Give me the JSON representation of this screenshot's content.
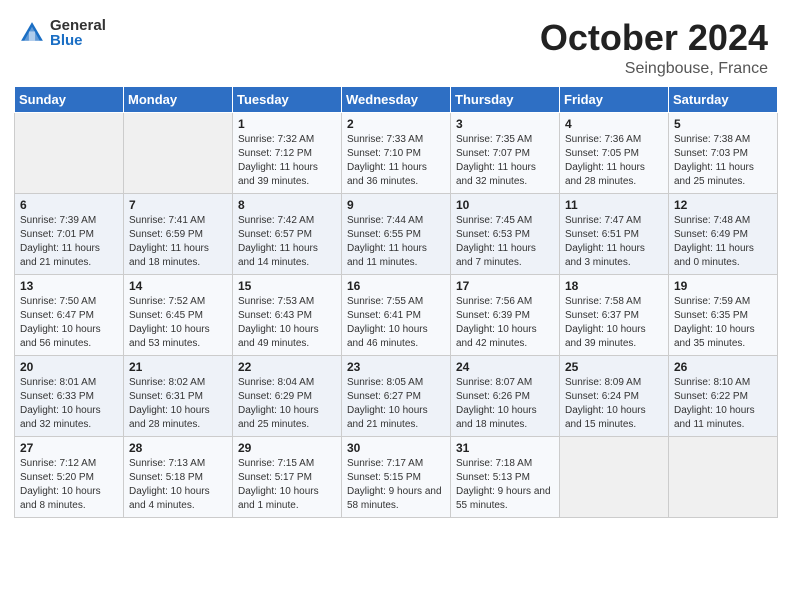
{
  "header": {
    "logo_general": "General",
    "logo_blue": "Blue",
    "month_title": "October 2024",
    "location": "Seingbouse, France"
  },
  "days_of_week": [
    "Sunday",
    "Monday",
    "Tuesday",
    "Wednesday",
    "Thursday",
    "Friday",
    "Saturday"
  ],
  "weeks": [
    [
      {
        "day": "",
        "sunrise": "",
        "sunset": "",
        "daylight": ""
      },
      {
        "day": "",
        "sunrise": "",
        "sunset": "",
        "daylight": ""
      },
      {
        "day": "1",
        "sunrise": "Sunrise: 7:32 AM",
        "sunset": "Sunset: 7:12 PM",
        "daylight": "Daylight: 11 hours and 39 minutes."
      },
      {
        "day": "2",
        "sunrise": "Sunrise: 7:33 AM",
        "sunset": "Sunset: 7:10 PM",
        "daylight": "Daylight: 11 hours and 36 minutes."
      },
      {
        "day": "3",
        "sunrise": "Sunrise: 7:35 AM",
        "sunset": "Sunset: 7:07 PM",
        "daylight": "Daylight: 11 hours and 32 minutes."
      },
      {
        "day": "4",
        "sunrise": "Sunrise: 7:36 AM",
        "sunset": "Sunset: 7:05 PM",
        "daylight": "Daylight: 11 hours and 28 minutes."
      },
      {
        "day": "5",
        "sunrise": "Sunrise: 7:38 AM",
        "sunset": "Sunset: 7:03 PM",
        "daylight": "Daylight: 11 hours and 25 minutes."
      }
    ],
    [
      {
        "day": "6",
        "sunrise": "Sunrise: 7:39 AM",
        "sunset": "Sunset: 7:01 PM",
        "daylight": "Daylight: 11 hours and 21 minutes."
      },
      {
        "day": "7",
        "sunrise": "Sunrise: 7:41 AM",
        "sunset": "Sunset: 6:59 PM",
        "daylight": "Daylight: 11 hours and 18 minutes."
      },
      {
        "day": "8",
        "sunrise": "Sunrise: 7:42 AM",
        "sunset": "Sunset: 6:57 PM",
        "daylight": "Daylight: 11 hours and 14 minutes."
      },
      {
        "day": "9",
        "sunrise": "Sunrise: 7:44 AM",
        "sunset": "Sunset: 6:55 PM",
        "daylight": "Daylight: 11 hours and 11 minutes."
      },
      {
        "day": "10",
        "sunrise": "Sunrise: 7:45 AM",
        "sunset": "Sunset: 6:53 PM",
        "daylight": "Daylight: 11 hours and 7 minutes."
      },
      {
        "day": "11",
        "sunrise": "Sunrise: 7:47 AM",
        "sunset": "Sunset: 6:51 PM",
        "daylight": "Daylight: 11 hours and 3 minutes."
      },
      {
        "day": "12",
        "sunrise": "Sunrise: 7:48 AM",
        "sunset": "Sunset: 6:49 PM",
        "daylight": "Daylight: 11 hours and 0 minutes."
      }
    ],
    [
      {
        "day": "13",
        "sunrise": "Sunrise: 7:50 AM",
        "sunset": "Sunset: 6:47 PM",
        "daylight": "Daylight: 10 hours and 56 minutes."
      },
      {
        "day": "14",
        "sunrise": "Sunrise: 7:52 AM",
        "sunset": "Sunset: 6:45 PM",
        "daylight": "Daylight: 10 hours and 53 minutes."
      },
      {
        "day": "15",
        "sunrise": "Sunrise: 7:53 AM",
        "sunset": "Sunset: 6:43 PM",
        "daylight": "Daylight: 10 hours and 49 minutes."
      },
      {
        "day": "16",
        "sunrise": "Sunrise: 7:55 AM",
        "sunset": "Sunset: 6:41 PM",
        "daylight": "Daylight: 10 hours and 46 minutes."
      },
      {
        "day": "17",
        "sunrise": "Sunrise: 7:56 AM",
        "sunset": "Sunset: 6:39 PM",
        "daylight": "Daylight: 10 hours and 42 minutes."
      },
      {
        "day": "18",
        "sunrise": "Sunrise: 7:58 AM",
        "sunset": "Sunset: 6:37 PM",
        "daylight": "Daylight: 10 hours and 39 minutes."
      },
      {
        "day": "19",
        "sunrise": "Sunrise: 7:59 AM",
        "sunset": "Sunset: 6:35 PM",
        "daylight": "Daylight: 10 hours and 35 minutes."
      }
    ],
    [
      {
        "day": "20",
        "sunrise": "Sunrise: 8:01 AM",
        "sunset": "Sunset: 6:33 PM",
        "daylight": "Daylight: 10 hours and 32 minutes."
      },
      {
        "day": "21",
        "sunrise": "Sunrise: 8:02 AM",
        "sunset": "Sunset: 6:31 PM",
        "daylight": "Daylight: 10 hours and 28 minutes."
      },
      {
        "day": "22",
        "sunrise": "Sunrise: 8:04 AM",
        "sunset": "Sunset: 6:29 PM",
        "daylight": "Daylight: 10 hours and 25 minutes."
      },
      {
        "day": "23",
        "sunrise": "Sunrise: 8:05 AM",
        "sunset": "Sunset: 6:27 PM",
        "daylight": "Daylight: 10 hours and 21 minutes."
      },
      {
        "day": "24",
        "sunrise": "Sunrise: 8:07 AM",
        "sunset": "Sunset: 6:26 PM",
        "daylight": "Daylight: 10 hours and 18 minutes."
      },
      {
        "day": "25",
        "sunrise": "Sunrise: 8:09 AM",
        "sunset": "Sunset: 6:24 PM",
        "daylight": "Daylight: 10 hours and 15 minutes."
      },
      {
        "day": "26",
        "sunrise": "Sunrise: 8:10 AM",
        "sunset": "Sunset: 6:22 PM",
        "daylight": "Daylight: 10 hours and 11 minutes."
      }
    ],
    [
      {
        "day": "27",
        "sunrise": "Sunrise: 7:12 AM",
        "sunset": "Sunset: 5:20 PM",
        "daylight": "Daylight: 10 hours and 8 minutes."
      },
      {
        "day": "28",
        "sunrise": "Sunrise: 7:13 AM",
        "sunset": "Sunset: 5:18 PM",
        "daylight": "Daylight: 10 hours and 4 minutes."
      },
      {
        "day": "29",
        "sunrise": "Sunrise: 7:15 AM",
        "sunset": "Sunset: 5:17 PM",
        "daylight": "Daylight: 10 hours and 1 minute."
      },
      {
        "day": "30",
        "sunrise": "Sunrise: 7:17 AM",
        "sunset": "Sunset: 5:15 PM",
        "daylight": "Daylight: 9 hours and 58 minutes."
      },
      {
        "day": "31",
        "sunrise": "Sunrise: 7:18 AM",
        "sunset": "Sunset: 5:13 PM",
        "daylight": "Daylight: 9 hours and 55 minutes."
      },
      {
        "day": "",
        "sunrise": "",
        "sunset": "",
        "daylight": ""
      },
      {
        "day": "",
        "sunrise": "",
        "sunset": "",
        "daylight": ""
      }
    ]
  ]
}
